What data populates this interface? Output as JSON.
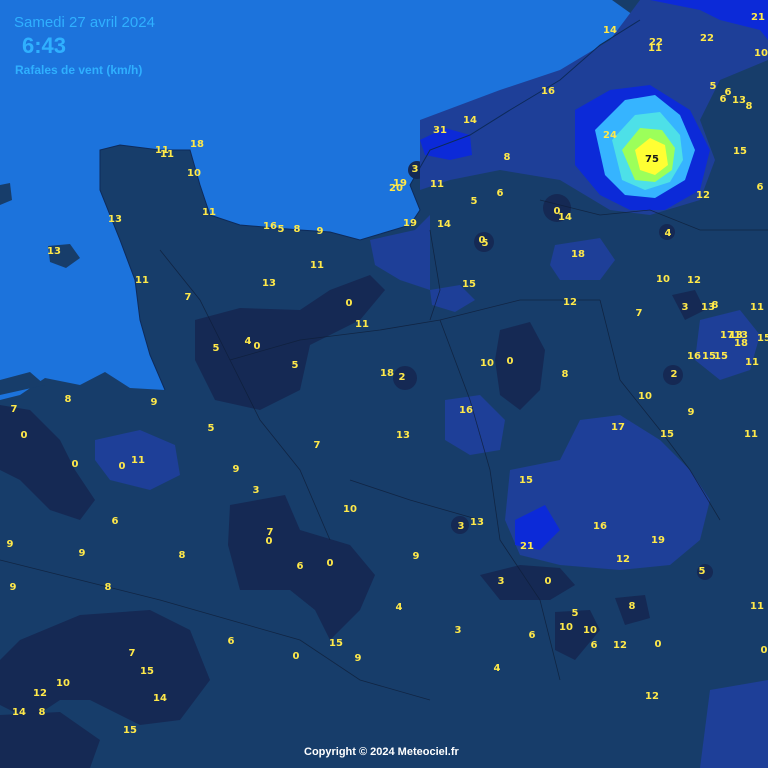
{
  "header": {
    "date": "Samedi 27 avril 2024",
    "time": "6:43",
    "variable": "Rafales de vent (km/h)"
  },
  "footer": {
    "copyright": "Copyright © 2024 Meteociel.fr"
  },
  "colors": {
    "sea": "#1c73dc",
    "gust_0_5": "#152954",
    "gust_5_15": "#173d6a",
    "gust_15_25": "#1e3f98",
    "gust_25_35": "#0c2ad8",
    "gust_50": "#36b4ff",
    "gust_60": "#9cff5a",
    "gust_75": "#ffff33",
    "value_text": "#ffe94a"
  },
  "gust_values": [
    "14",
    "22",
    "11",
    "22",
    "21",
    "10",
    "16",
    "5",
    "6",
    "6",
    "13",
    "8",
    "31",
    "14",
    "24",
    "75",
    "15",
    "11",
    "18",
    "11",
    "10",
    "8",
    "3",
    "11",
    "20",
    "19",
    "6",
    "5",
    "0",
    "14",
    "12",
    "6",
    "11",
    "13",
    "16",
    "5",
    "8",
    "9",
    "19",
    "14",
    "0",
    "5",
    "4",
    "13",
    "11",
    "18",
    "7",
    "13",
    "11",
    "0",
    "10",
    "12",
    "15",
    "3",
    "8",
    "13",
    "11",
    "12",
    "7",
    "11",
    "17",
    "13",
    "13",
    "18",
    "15",
    "4",
    "0",
    "5",
    "16",
    "15",
    "15",
    "11",
    "5",
    "18",
    "2",
    "10",
    "0",
    "8",
    "2",
    "7",
    "8",
    "9",
    "10",
    "0",
    "16",
    "9",
    "5",
    "17",
    "15",
    "11",
    "0",
    "0",
    "11",
    "7",
    "13",
    "9",
    "3",
    "15",
    "3",
    "7",
    "0",
    "10",
    "13",
    "16",
    "19",
    "21",
    "9",
    "9",
    "8",
    "0",
    "6",
    "9",
    "12",
    "3",
    "0",
    "5",
    "6",
    "9",
    "8",
    "11",
    "5",
    "4",
    "8",
    "10",
    "10",
    "3",
    "6",
    "6",
    "12",
    "0",
    "0",
    "6",
    "7",
    "15",
    "9",
    "0",
    "4",
    "15",
    "10",
    "12",
    "14",
    "8",
    "14",
    "12",
    "15"
  ]
}
